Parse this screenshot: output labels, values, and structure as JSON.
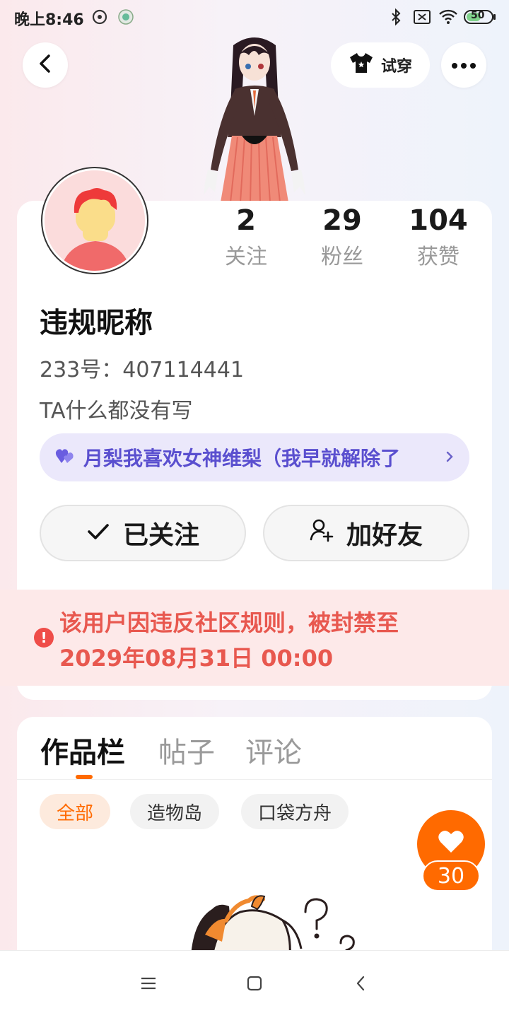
{
  "status_bar": {
    "time": "晚上8:46",
    "battery": "50"
  },
  "header": {
    "try_on_label": "试穿"
  },
  "profile": {
    "stats": [
      {
        "value": "2",
        "label": "关注"
      },
      {
        "value": "29",
        "label": "粉丝"
      },
      {
        "value": "104",
        "label": "获赞"
      }
    ],
    "nickname": "违规昵称",
    "uid": "233号：407114441",
    "bio": "TA什么都没有写",
    "fan_tag": "月梨我喜欢女神维梨（我早就解除了"
  },
  "actions": {
    "followed_label": "已关注",
    "add_friend_label": "加好友"
  },
  "ban_notice": {
    "line1": "该用户因违反社区规则，被封禁至",
    "line2": "2029年08月31日 00:00"
  },
  "tabs": [
    {
      "label": "作品栏"
    },
    {
      "label": "帖子"
    },
    {
      "label": "评论"
    }
  ],
  "filters": [
    {
      "label": "全部"
    },
    {
      "label": "造物岛"
    },
    {
      "label": "口袋方舟"
    }
  ],
  "like_fab": {
    "count": "30"
  },
  "colors": {
    "accent": "#ff6a00",
    "ban_text": "#e8584f",
    "tag_text": "#5a4fcf"
  }
}
